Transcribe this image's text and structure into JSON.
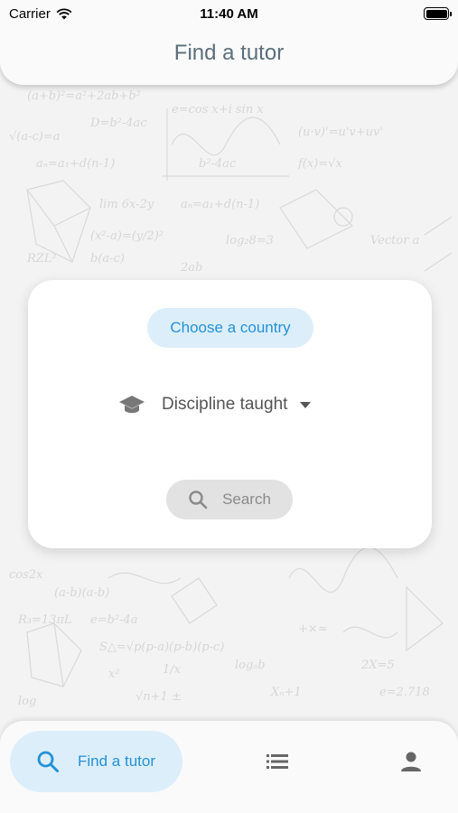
{
  "status_bar": {
    "carrier": "Carrier",
    "time": "11:40 AM"
  },
  "header": {
    "title": "Find a tutor"
  },
  "card": {
    "country_button": "Choose a country",
    "discipline_select": "Discipline taught",
    "search_button": "Search"
  },
  "bottom_nav": {
    "find_tutor_label": "Find a tutor",
    "items": [
      {
        "icon": "search-icon",
        "label": "Find a tutor",
        "active": true
      },
      {
        "icon": "list-icon"
      },
      {
        "icon": "person-icon"
      }
    ]
  },
  "colors": {
    "accent": "#2491d6",
    "accent_bg": "#ddeefb",
    "header_title": "#5b6f7a"
  }
}
